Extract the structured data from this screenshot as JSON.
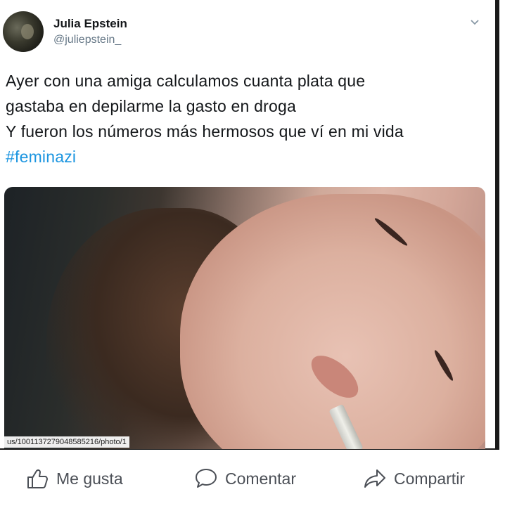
{
  "tweet": {
    "display_name": "Julia Epstein",
    "handle": "@juliepstein_",
    "text_lines": [
      "Ayer con una amiga calculamos cuanta plata que",
      "gastaba en depilarme la gasto en droga",
      "Y fueron los números más hermosos que ví en mi vida"
    ],
    "hashtag": "#feminazi",
    "photo_url_tag": "us/1001137279048585216/photo/1"
  },
  "actions": {
    "like": "Me gusta",
    "comment": "Comentar",
    "share": "Compartir"
  },
  "icons": {
    "menu": "chevron-down-icon",
    "like": "thumbs-up-icon",
    "comment": "speech-bubble-icon",
    "share": "share-arrow-icon"
  },
  "colors": {
    "hashtag": "#1b95e0",
    "handle": "#657786",
    "action_text": "#4b4f56"
  }
}
